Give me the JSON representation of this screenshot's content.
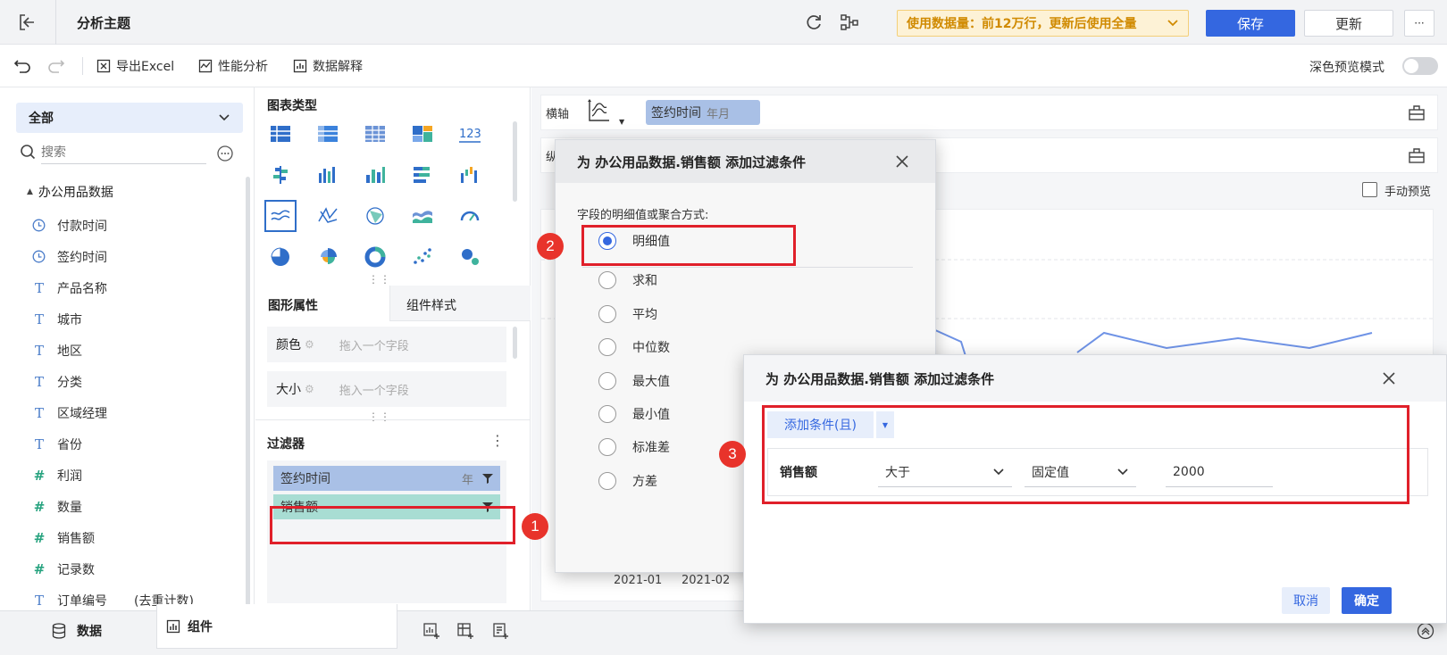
{
  "topbar": {
    "title": "分析主题",
    "data_usage_notice": "使用数据量：前12万行，更新后使用全量",
    "save_label": "保存",
    "update_label": "更新",
    "more_label": "···"
  },
  "toolbar": {
    "export_excel": "导出Excel",
    "perf_analysis": "性能分析",
    "data_explain": "数据解释",
    "dark_preview": "深色预览模式"
  },
  "leftpane": {
    "scope_select": "全部",
    "search_placeholder": "搜索",
    "dataset_name": "办公用品数据",
    "fields": [
      {
        "type": "time",
        "label": "付款时间"
      },
      {
        "type": "time",
        "label": "签约时间"
      },
      {
        "type": "text",
        "label": "产品名称"
      },
      {
        "type": "text",
        "label": "城市"
      },
      {
        "type": "text",
        "label": "地区"
      },
      {
        "type": "text",
        "label": "分类"
      },
      {
        "type": "text",
        "label": "区域经理"
      },
      {
        "type": "text",
        "label": "省份"
      },
      {
        "type": "number",
        "label": "利润"
      },
      {
        "type": "number",
        "label": "数量"
      },
      {
        "type": "number",
        "label": "销售额"
      },
      {
        "type": "number",
        "label": "记录数"
      },
      {
        "type": "text",
        "label": "订单编号",
        "suffix": "(去重计数)"
      }
    ]
  },
  "midpane": {
    "chart_type_title": "图表类型",
    "tab_shape": "图形属性",
    "tab_style": "组件样式",
    "color_label": "颜色",
    "size_label": "大小",
    "drop_hint": "拖入一个字段",
    "filter_title": "过滤器",
    "filter_chips": [
      {
        "label": "签约时间",
        "unit": "年"
      },
      {
        "label": "销售额",
        "unit": ""
      }
    ]
  },
  "rightpane": {
    "x_axis_label": "横轴",
    "y_axis_label": "纵",
    "x_field": "签约时间",
    "x_field_unit": "年月",
    "manual_preview": "手动预览",
    "x_ticks": [
      "2021-01",
      "2021-02"
    ]
  },
  "dialog1": {
    "title": "为 办公用品数据.销售额 添加过滤条件",
    "prompt": "字段的明细值或聚合方式:",
    "options": [
      "明细值",
      "求和",
      "平均",
      "中位数",
      "最大值",
      "最小值",
      "标准差",
      "方差"
    ],
    "selected": "明细值"
  },
  "dialog2": {
    "title": "为 办公用品数据.销售额 添加过滤条件",
    "add_condition": "添加条件(且)",
    "condition_field": "销售额",
    "operator": "大于",
    "value_type": "固定值",
    "value": "2000",
    "cancel": "取消",
    "confirm": "确定"
  },
  "markers": [
    "1",
    "2",
    "3"
  ],
  "bottombar": {
    "tab_data": "数据",
    "tab_component": "组件"
  },
  "colors": {
    "primary": "#3467e0",
    "annotation_red": "#e0202a",
    "filter_time_chip": "#a9c0e6",
    "filter_measure_chip": "#a8ddd3"
  }
}
